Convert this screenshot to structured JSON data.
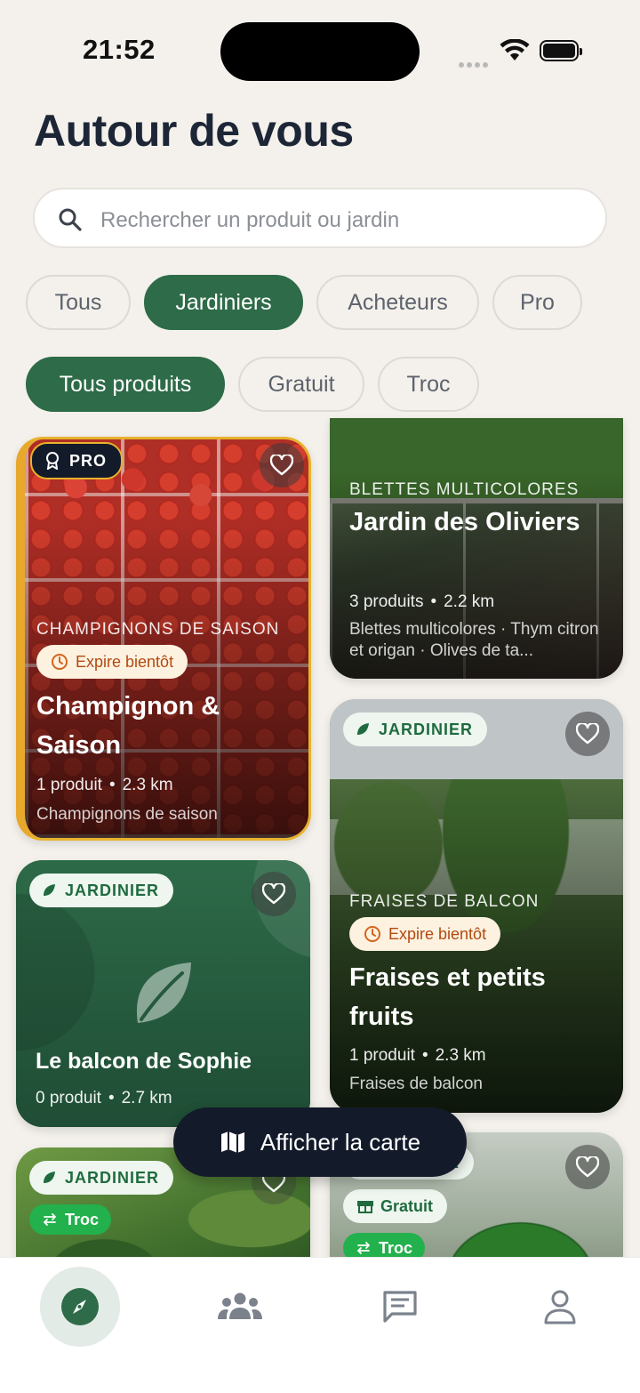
{
  "status": {
    "time": "21:52"
  },
  "header": {
    "title": "Autour de vous"
  },
  "search": {
    "placeholder": "Rechercher un produit ou jardin"
  },
  "filters_type": [
    "Tous",
    "Jardiniers",
    "Acheteurs",
    "Pro"
  ],
  "filters_type_active": "Jardiniers",
  "filters_product": [
    "Tous produits",
    "Gratuit",
    "Troc"
  ],
  "filters_product_active": "Tous produits",
  "cards": {
    "c1": {
      "badge": "PRO",
      "overline": "CHAMPIGNONS DE SAISON",
      "expire": "Expire bientôt",
      "title": "Champignon & Saison",
      "count": "1 produit",
      "distance": "2.3 km",
      "desc": "Champignons de saison"
    },
    "c2": {
      "overline": "BLETTES MULTICOLORES",
      "title": "Jardin des Oliviers",
      "count": "3 produits",
      "distance": "2.2 km",
      "desc": "Blettes multicolores · Thym citron et origan · Olives de ta..."
    },
    "c3": {
      "badge": "JARDINIER",
      "title": "Le balcon de Sophie",
      "count": "0 produit",
      "distance": "2.7 km"
    },
    "c4": {
      "badge": "JARDINIER",
      "overline": "FRAISES DE BALCON",
      "expire": "Expire bientôt",
      "title": "Fraises et petits fruits",
      "count": "1 produit",
      "distance": "2.3 km",
      "desc": "Fraises de balcon"
    },
    "c5": {
      "badge": "JARDINIER",
      "troc": "Troc"
    },
    "c6": {
      "badge_partial": "ER",
      "gratuit": "Gratuit",
      "troc": "Troc"
    }
  },
  "map_button": {
    "label": "Afficher la carte"
  },
  "tabbar": {
    "items": [
      "compass-icon",
      "community-icon",
      "messages-icon",
      "profile-icon"
    ],
    "active": "compass-icon"
  },
  "colors": {
    "brand_green": "#2e6b48",
    "background": "#f4f1ec",
    "pro_gold": "#e7b22c",
    "dark": "#131a2a"
  }
}
